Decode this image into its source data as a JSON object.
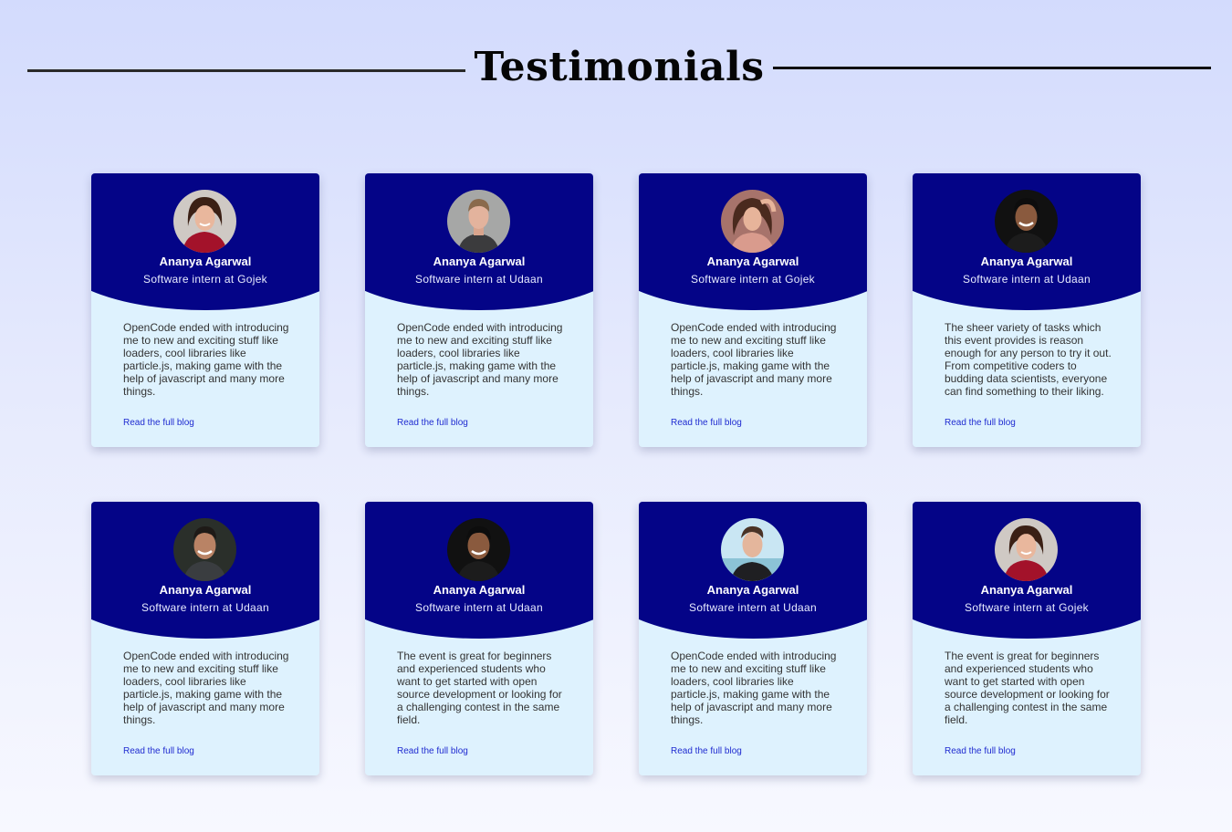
{
  "header": {
    "title": "Testimonials"
  },
  "theme": {
    "card_top_color": "#040487",
    "card_body_color": "#def2fe",
    "link_color": "#1f2bd0"
  },
  "testimonials": [
    {
      "name": "Ananya Agarwal",
      "role": "Software intern at Gojek",
      "quote": "OpenCode ended with introducing me to new and exciting stuff like loaders, cool libraries like particle.js, making game with the help of javascript and many more things.",
      "link": "Read the full blog",
      "avatar": "woman-red-top-avatar"
    },
    {
      "name": "Ananya Agarwal",
      "role": "Software intern at Udaan",
      "quote": "OpenCode ended with introducing me to new and exciting stuff like loaders, cool libraries like particle.js, making game with the help of javascript and many more things.",
      "link": "Read the full blog",
      "avatar": "man-grey-background-avatar"
    },
    {
      "name": "Ananya Agarwal",
      "role": "Software intern at Gojek",
      "quote": "OpenCode ended with introducing me to new and exciting stuff like loaders, cool libraries like particle.js, making game with the help of javascript and many more things.",
      "link": "Read the full blog",
      "avatar": "woman-curly-hair-avatar"
    },
    {
      "name": "Ananya Agarwal",
      "role": "Software intern at Udaan",
      "quote": "The sheer variety of tasks which this event provides is reason enough for any person to try it out. From competitive coders to budding data scientists, everyone can find something to their liking.",
      "link": "Read the full blog",
      "avatar": "man-dark-background-avatar"
    },
    {
      "name": "Ananya Agarwal",
      "role": "Software intern at Udaan",
      "quote": "OpenCode ended with introducing me to new and exciting stuff like loaders, cool libraries like particle.js, making game with the help of javascript and many more things.",
      "link": "Read the full blog",
      "avatar": "man-smiling-avatar"
    },
    {
      "name": "Ananya Agarwal",
      "role": "Software intern at Udaan",
      "quote": "The event is great for beginners and experienced students who want to get started with open source development or looking for a challenging contest in the same field.",
      "link": "Read the full blog",
      "avatar": "man-dark-background-avatar"
    },
    {
      "name": "Ananya Agarwal",
      "role": "Software intern at Udaan",
      "quote": "OpenCode ended with introducing me to new and exciting stuff like loaders, cool libraries like particle.js, making game with the help of javascript and many more things.",
      "link": "Read the full blog",
      "avatar": "man-sky-background-avatar"
    },
    {
      "name": "Ananya Agarwal",
      "role": "Software intern at Gojek",
      "quote": "The event is great for beginners and experienced students who want to get started with open source development or looking for a challenging contest in the same field.",
      "link": "Read the full blog",
      "avatar": "woman-red-top-avatar"
    }
  ]
}
